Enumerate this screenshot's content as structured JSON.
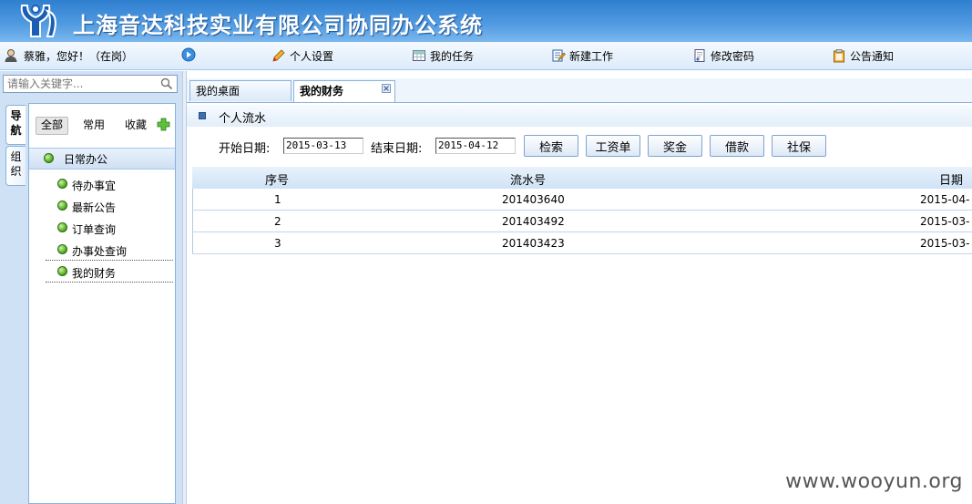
{
  "app": {
    "title": "上海音达科技实业有限公司协同办公系统"
  },
  "user": {
    "greeting": "蔡雅，您好！（在岗）"
  },
  "menu": [
    {
      "label": "个人设置",
      "icon": "pencil-icon"
    },
    {
      "label": "我的任务",
      "icon": "table-icon"
    },
    {
      "label": "新建工作",
      "icon": "edit-doc-icon"
    },
    {
      "label": "修改密码",
      "icon": "doc-key-icon"
    },
    {
      "label": "公告通知",
      "icon": "clipboard-icon"
    }
  ],
  "sidebar": {
    "search_placeholder": "请输入关键字...",
    "vtabs": [
      {
        "label": "导航"
      },
      {
        "label": "组织"
      }
    ],
    "filters": [
      {
        "label": "全部"
      },
      {
        "label": "常用"
      },
      {
        "label": "收藏"
      }
    ],
    "group": {
      "label": "日常办公"
    },
    "items": [
      {
        "label": "待办事宜"
      },
      {
        "label": "最新公告"
      },
      {
        "label": "订单查询"
      },
      {
        "label": "办事处查询"
      },
      {
        "label": "我的财务"
      }
    ]
  },
  "tabs": [
    {
      "label": "我的桌面"
    },
    {
      "label": "我的财务"
    }
  ],
  "section": {
    "title": "个人流水"
  },
  "form": {
    "start_label": "开始日期:",
    "start_value": "2015-03-13",
    "end_label": "结束日期:",
    "end_value": "2015-04-12",
    "buttons": [
      {
        "label": "检索"
      },
      {
        "label": "工资单"
      },
      {
        "label": "奖金"
      },
      {
        "label": "借款"
      },
      {
        "label": "社保"
      }
    ]
  },
  "table": {
    "columns": [
      "序号",
      "流水号",
      "日期"
    ],
    "rows": [
      {
        "seq": "1",
        "serial": "201403640",
        "date": "2015-04-"
      },
      {
        "seq": "2",
        "serial": "201403492",
        "date": "2015-03-"
      },
      {
        "seq": "3",
        "serial": "201403423",
        "date": "2015-03-"
      }
    ]
  },
  "watermark": "www.wooyun.org",
  "colors": {
    "header_blue": "#2f7fd0",
    "panel_blue": "#cfe2f5",
    "status_green": "#4aa21a"
  }
}
